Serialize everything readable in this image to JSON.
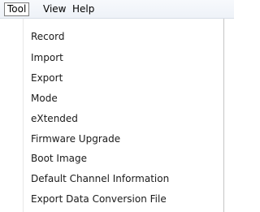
{
  "menubar": {
    "items": [
      {
        "label": "Tool",
        "active": true
      },
      {
        "label": "View",
        "active": false
      },
      {
        "label": "Help",
        "active": false
      }
    ]
  },
  "tool_menu": {
    "items": [
      {
        "label": "Record"
      },
      {
        "label": "Import"
      },
      {
        "label": "Export"
      },
      {
        "label": "Mode"
      },
      {
        "label": "eXtended"
      },
      {
        "label": "Firmware Upgrade"
      },
      {
        "label": "Boot Image"
      },
      {
        "label": "Default Channel Information"
      },
      {
        "label": "Export Data Conversion File"
      }
    ]
  }
}
